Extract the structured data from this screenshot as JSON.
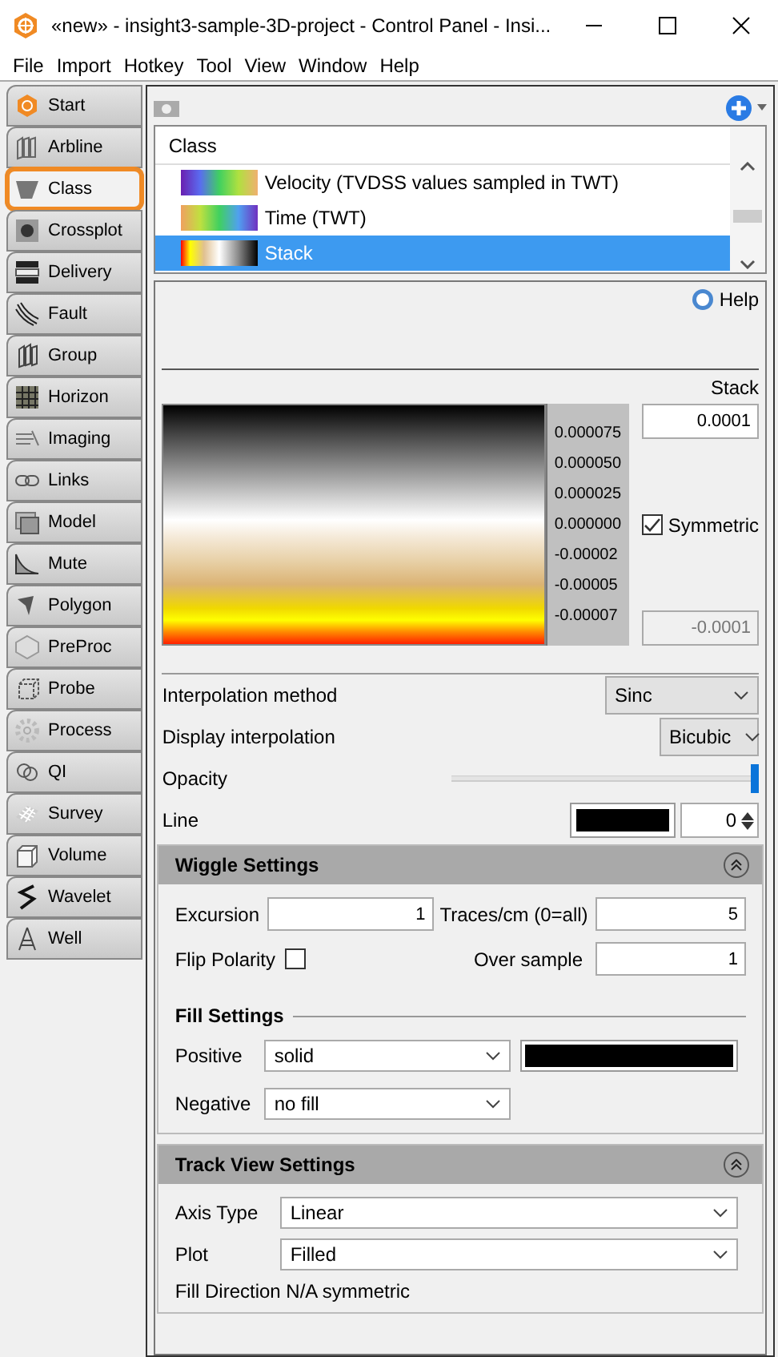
{
  "window": {
    "title": "«new» - insight3-sample-3D-project - Control Panel - Insi..."
  },
  "menu": [
    "File",
    "Import",
    "Hotkey",
    "Tool",
    "View",
    "Window",
    "Help"
  ],
  "sidebar": {
    "items": [
      {
        "label": "Start",
        "selected": false
      },
      {
        "label": "Arbline",
        "selected": false
      },
      {
        "label": "Class",
        "selected": true
      },
      {
        "label": "Crossplot",
        "selected": false
      },
      {
        "label": "Delivery",
        "selected": false
      },
      {
        "label": "Fault",
        "selected": false
      },
      {
        "label": "Group",
        "selected": false
      },
      {
        "label": "Horizon",
        "selected": false
      },
      {
        "label": "Imaging",
        "selected": false
      },
      {
        "label": "Links",
        "selected": false
      },
      {
        "label": "Model",
        "selected": false
      },
      {
        "label": "Mute",
        "selected": false
      },
      {
        "label": "Polygon",
        "selected": false
      },
      {
        "label": "PreProc",
        "selected": false
      },
      {
        "label": "Probe",
        "selected": false
      },
      {
        "label": "Process",
        "selected": false
      },
      {
        "label": "QI",
        "selected": false
      },
      {
        "label": "Survey",
        "selected": false
      },
      {
        "label": "Volume",
        "selected": false
      },
      {
        "label": "Wavelet",
        "selected": false
      },
      {
        "label": "Well",
        "selected": false
      }
    ]
  },
  "class_list": {
    "header": "Class",
    "items": [
      {
        "label": "Velocity (TVDSS values sampled in TWT)",
        "kind": "velocity",
        "selected": false
      },
      {
        "label": "Time (TWT)",
        "kind": "time",
        "selected": false
      },
      {
        "label": "Stack",
        "kind": "stack",
        "selected": true
      }
    ]
  },
  "help": "Help",
  "colorbar": {
    "title": "Stack",
    "max": "0.0001",
    "min": "-0.0001",
    "symmetric": {
      "label": "Symmetric",
      "checked": true
    },
    "ticks": [
      "0.000075",
      "0.000050",
      "0.000025",
      "0.000000",
      "-0.00002",
      "-0.00005",
      "-0.00007"
    ]
  },
  "interpolation_method": {
    "label": "Interpolation method",
    "value": "Sinc"
  },
  "display_interpolation": {
    "label": "Display interpolation",
    "value": "Bicubic"
  },
  "opacity": {
    "label": "Opacity",
    "level": 1
  },
  "line": {
    "label": "Line",
    "color": "#000000",
    "value": "0"
  },
  "wiggle_settings": {
    "title": "Wiggle Settings",
    "excursion": {
      "label": "Excursion",
      "value": "1"
    },
    "traces": {
      "label": "Traces/cm (0=all)",
      "value": "5"
    },
    "flip_polarity": {
      "label": "Flip Polarity",
      "checked": false
    },
    "over_sample": {
      "label": "Over sample",
      "value": "1"
    }
  },
  "fill_settings": {
    "title": "Fill Settings",
    "positive": {
      "label": "Positive",
      "value": "solid",
      "color": "#000000"
    },
    "negative": {
      "label": "Negative",
      "value": "no fill"
    }
  },
  "track_view_settings": {
    "title": "Track View Settings",
    "axis_type": {
      "label": "Axis Type",
      "value": "Linear"
    },
    "plot": {
      "label": "Plot",
      "value": "Filled"
    },
    "fill_direction": "Fill Direction N/A symmetric"
  }
}
